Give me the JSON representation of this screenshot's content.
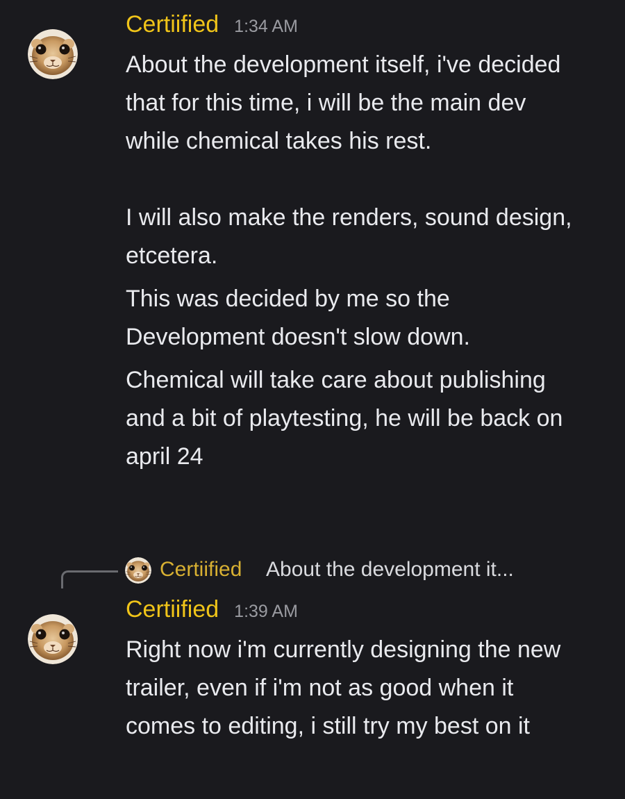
{
  "messages": [
    {
      "author": "Certiified",
      "time": "1:34 AM",
      "avatar_icon": "hamster-face-avatar",
      "author_color": "#f0c419",
      "paragraphs": [
        "About the development itself, i've decided that for this time, i will be the main dev while chemical takes his rest.",
        "I will also make the renders, sound design, etcetera.",
        "This was decided by me so the Development doesn't slow down.",
        "Chemical will take care about publishing and a bit of playtesting, he will be back on april 24"
      ]
    },
    {
      "author": "Certiified",
      "time": "1:39 AM",
      "avatar_icon": "hamster-face-avatar",
      "author_color": "#f0c419",
      "reply_to": {
        "author": "Certiified",
        "snippet": "About the development it..."
      },
      "paragraphs": [
        "Right now i'm currently designing the new trailer, even if i'm not as good when it comes to editing, i still try my best on it"
      ]
    }
  ]
}
